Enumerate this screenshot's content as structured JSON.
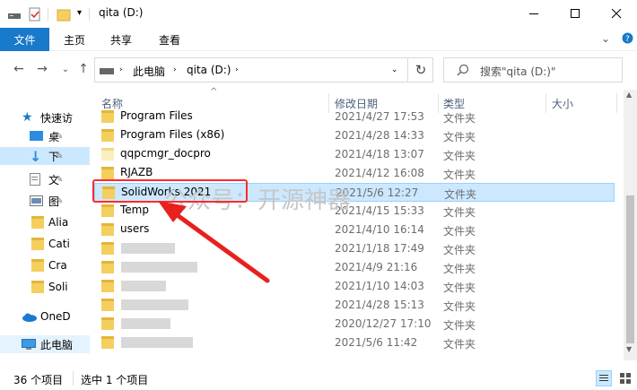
{
  "window": {
    "title": "qita (D:)",
    "controls": [
      "minimize",
      "maximize",
      "close"
    ]
  },
  "ribbon": {
    "file_tab": "文件",
    "tabs": [
      "主页",
      "共享",
      "查看"
    ]
  },
  "address": {
    "crumbs": [
      "此电脑",
      "qita (D:)"
    ],
    "search_placeholder": "搜索\"qita (D:)\""
  },
  "columns": {
    "name": "名称",
    "date": "修改日期",
    "type": "类型",
    "size": "大小"
  },
  "nav": {
    "items": [
      {
        "label": "快速访"
      },
      {
        "label": "桌"
      },
      {
        "label": "下"
      },
      {
        "label": "文"
      },
      {
        "label": "图"
      },
      {
        "label": "Alia"
      },
      {
        "label": "Cati"
      },
      {
        "label": "Cra"
      },
      {
        "label": "Soli"
      },
      {
        "label": "OneD"
      },
      {
        "label": "此电脑"
      }
    ]
  },
  "files": [
    {
      "name": "Program Files",
      "date": "2021/4/27 17:53",
      "type": "文件夹"
    },
    {
      "name": "Program Files (x86)",
      "date": "2021/4/28 14:33",
      "type": "文件夹"
    },
    {
      "name": "qqpcmgr_docpro",
      "date": "2021/4/18 13:07",
      "type": "文件夹"
    },
    {
      "name": "RJAZB",
      "date": "2021/4/12 16:08",
      "type": "文件夹"
    },
    {
      "name": "SolidWorks 2021",
      "date": "2021/5/6 12:27",
      "type": "文件夹"
    },
    {
      "name": "Temp",
      "date": "2021/4/15 15:33",
      "type": "文件夹"
    },
    {
      "name": "users",
      "date": "2021/4/10 16:14",
      "type": "文件夹"
    },
    {
      "name": "",
      "date": "2021/1/18 17:49",
      "type": "文件夹"
    },
    {
      "name": "",
      "date": "2021/4/9 21:16",
      "type": "文件夹"
    },
    {
      "name": "",
      "date": "2021/1/10 14:03",
      "type": "文件夹"
    },
    {
      "name": "",
      "date": "2021/4/28 15:13",
      "type": "文件夹"
    },
    {
      "name": "",
      "date": "2020/12/27 17:10",
      "type": "文件夹"
    },
    {
      "name": "",
      "date": "2021/5/6 11:42",
      "type": "文件夹"
    }
  ],
  "status": {
    "count": "36 个项目",
    "selected": "选中 1 个项目"
  },
  "watermark": "公众号：开源神器",
  "colors": {
    "accent": "#1979ca",
    "selection": "#cce8ff",
    "annotation": "#ff2a2a",
    "folder": "#f4cf5e"
  }
}
